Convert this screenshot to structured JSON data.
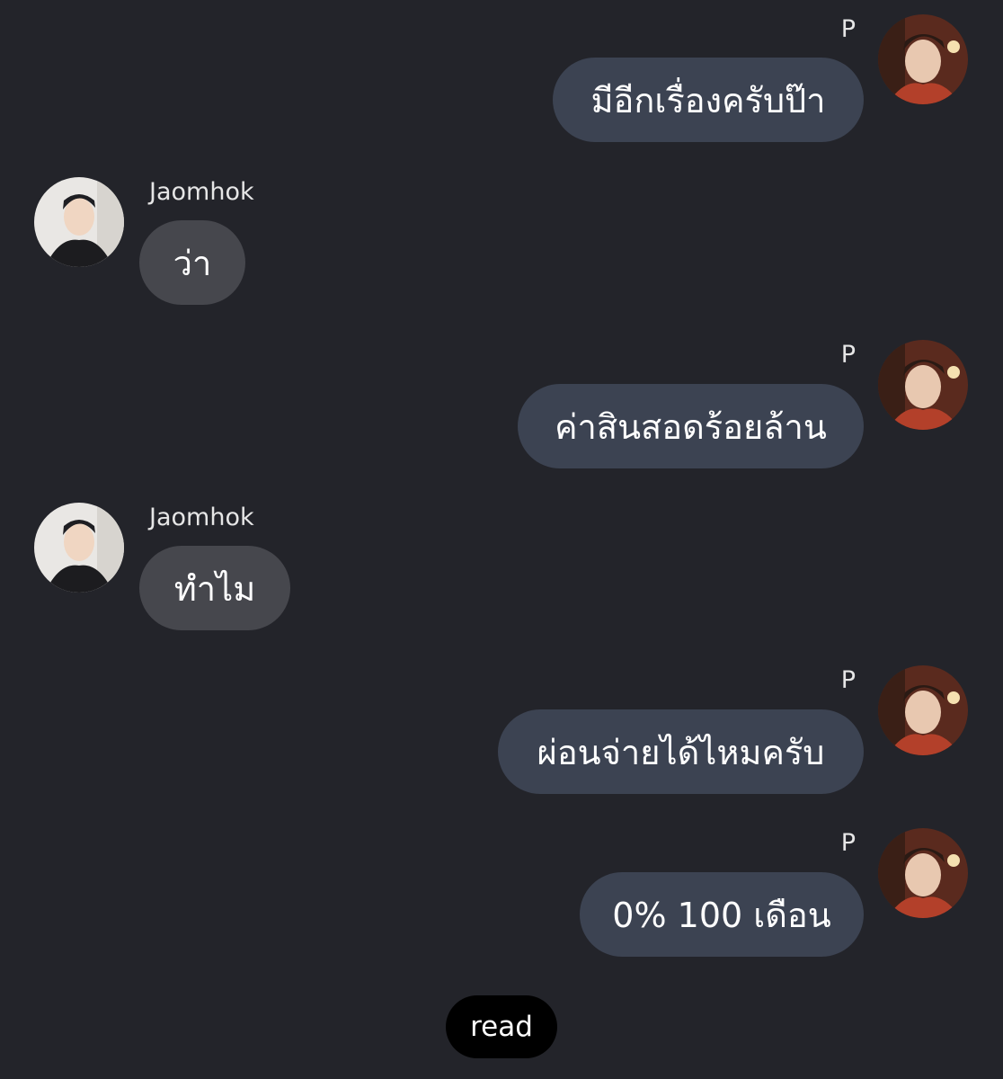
{
  "chat": {
    "messages": [
      {
        "sender": "P",
        "text": "มีอีกเรื่องครับป๊า",
        "direction": "outgoing"
      },
      {
        "sender": "Jaomhok",
        "text": "ว่า",
        "direction": "incoming"
      },
      {
        "sender": "P",
        "text": "ค่าสินสอดร้อยล้าน",
        "direction": "outgoing"
      },
      {
        "sender": "Jaomhok",
        "text": "ทำไม",
        "direction": "incoming"
      },
      {
        "sender": "P",
        "text": "ผ่อนจ่ายได้ไหมครับ",
        "direction": "outgoing"
      },
      {
        "sender": "P",
        "text": "0% 100 เดือน",
        "direction": "outgoing"
      }
    ],
    "read_status": "read"
  },
  "colors": {
    "background": "#23242a",
    "outgoing_bubble": "#3c4352",
    "incoming_bubble": "#46474d",
    "read_pill": "#000000"
  }
}
